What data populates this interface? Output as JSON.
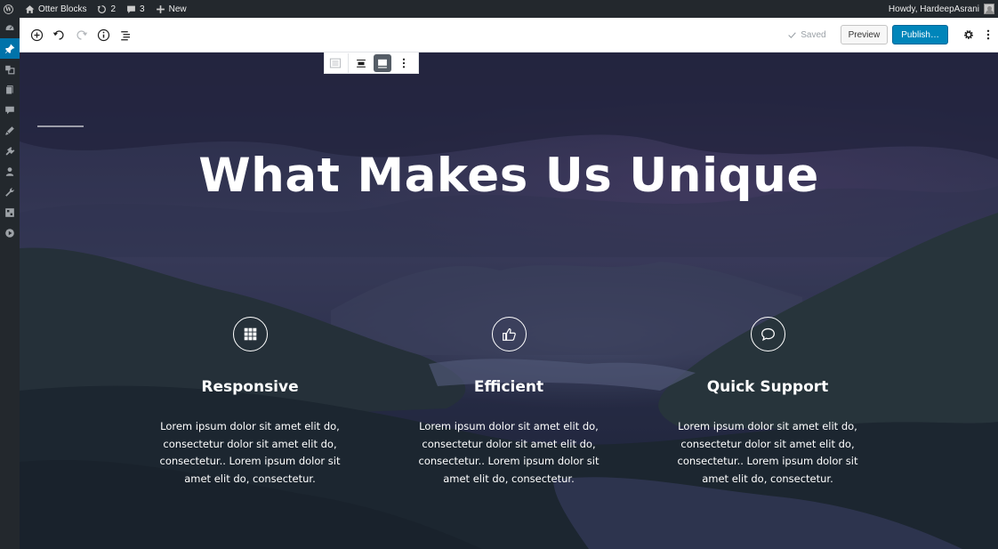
{
  "admin_bar": {
    "site_name": "Otter Blocks",
    "updates_count": "2",
    "comments_count": "3",
    "new_label": "New",
    "greeting": "Howdy, HardeepAsrani"
  },
  "admin_menu": {
    "items": [
      "dashboard-icon",
      "pin-icon",
      "media-icon",
      "pages-icon",
      "comments-icon",
      "appearance-icon",
      "plugins-icon",
      "users-icon",
      "tools-icon",
      "settings-icon",
      "play-icon"
    ]
  },
  "editor_header": {
    "saved_label": "Saved",
    "preview_label": "Preview",
    "publish_label": "Publish…"
  },
  "content": {
    "heading": "What Makes Us Unique",
    "features": [
      {
        "icon": "grid-icon",
        "title": "Responsive",
        "text": "Lorem ipsum dolor sit amet elit do, consectetur dolor sit amet elit do, consectetur.. Lorem ipsum dolor sit amet elit do, consectetur."
      },
      {
        "icon": "thumbs-up-icon",
        "title": "Efficient",
        "text": "Lorem ipsum dolor sit amet elit do, consectetur dolor sit amet elit do, consectetur.. Lorem ipsum dolor sit amet elit do, consectetur."
      },
      {
        "icon": "comment-icon",
        "title": "Quick Support",
        "text": "Lorem ipsum dolor sit amet elit do, consectetur dolor sit amet elit do, consectetur.. Lorem ipsum dolor sit amet elit do, consectetur."
      }
    ]
  },
  "colors": {
    "admin_bar": "#23282d",
    "accent": "#0073aa",
    "publish": "#0085ba",
    "overlay": "#1e1f46"
  }
}
